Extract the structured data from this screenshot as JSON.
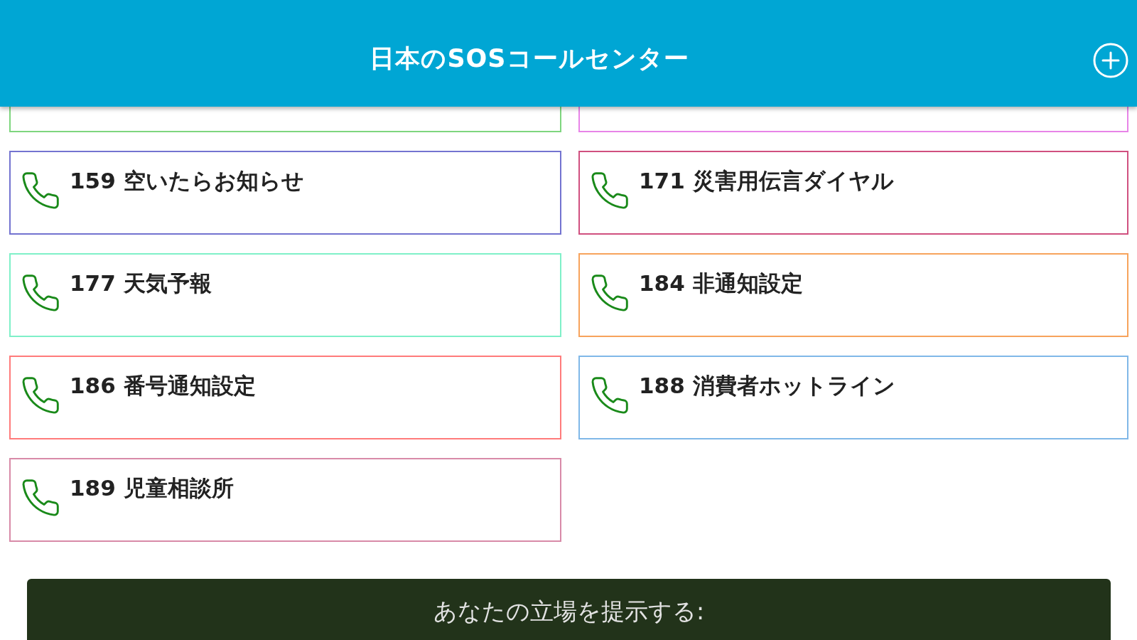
{
  "header": {
    "title": "日本のSOSコールセンター"
  },
  "cards": [
    {
      "kind": "partial",
      "color": "#7ed67e"
    },
    {
      "kind": "partial",
      "color": "#e884e8"
    },
    {
      "kind": "card",
      "label": "159 空いたらお知らせ",
      "color": "#7373d0"
    },
    {
      "kind": "card",
      "label": "171 災害用伝言ダイヤル",
      "color": "#d0507f"
    },
    {
      "kind": "card",
      "label": "177 天気予報",
      "color": "#7ff0c8"
    },
    {
      "kind": "card",
      "label": "184 非通知設定",
      "color": "#f7a35c"
    },
    {
      "kind": "card",
      "label": "186 番号通知設定",
      "color": "#ff7b7b"
    },
    {
      "kind": "card",
      "label": "188 消費者ホットライン",
      "color": "#80b8e8"
    },
    {
      "kind": "card",
      "label": "189 児童相談所",
      "color": "#d88aa8"
    }
  ],
  "footer_button": {
    "label": "あなたの立場を提示する:"
  }
}
